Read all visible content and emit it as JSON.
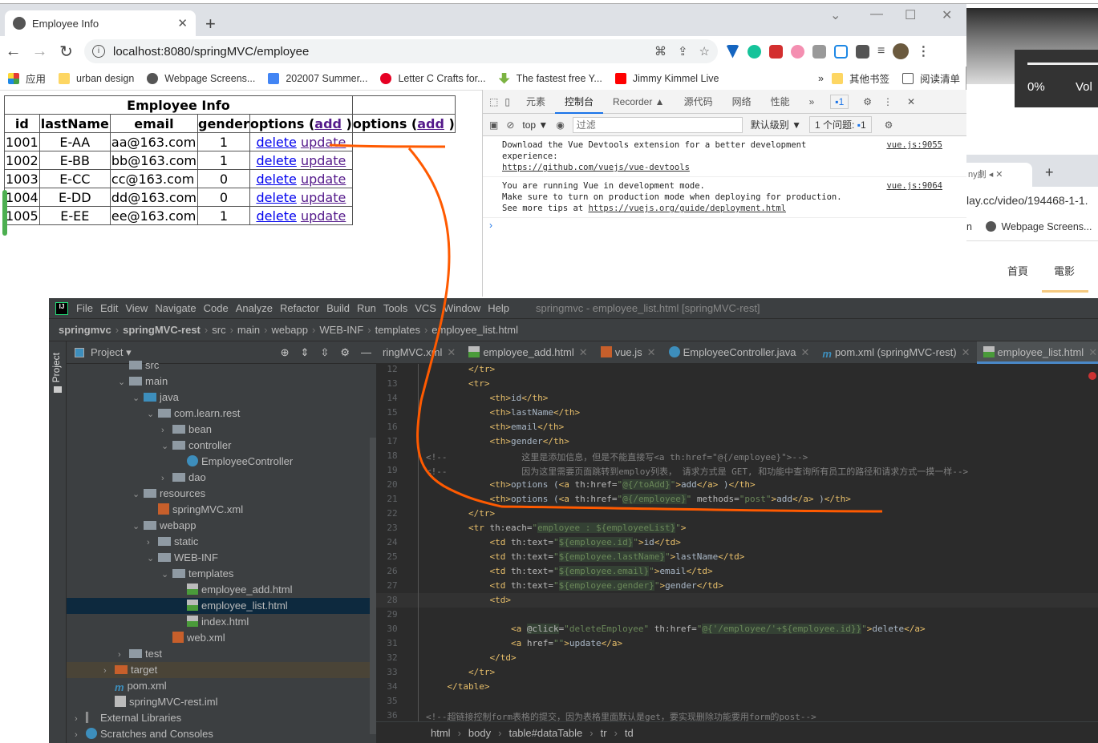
{
  "chrome": {
    "tab_title": "Employee Info",
    "url": "localhost:8080/springMVC/employee",
    "bookmarks": [
      "应用",
      "urban design",
      "Webpage Screens...",
      "202007 Summer...",
      "Letter C Crafts for...",
      "The fastest free Y...",
      "Jimmy Kimmel Live",
      "其他书签",
      "阅读清单"
    ],
    "more_bookmarks": "»"
  },
  "page": {
    "table_caption": "Employee Info",
    "headers": [
      "id",
      "lastName",
      "email",
      "gender"
    ],
    "options_label": "options (",
    "add_label": "add",
    "close_paren": " )",
    "rows": [
      {
        "id": "1001",
        "lastName": "E-AA",
        "email": "aa@163.com",
        "gender": "1"
      },
      {
        "id": "1002",
        "lastName": "E-BB",
        "email": "bb@163.com",
        "gender": "1"
      },
      {
        "id": "1003",
        "lastName": "E-CC",
        "email": "cc@163.com",
        "gender": "0"
      },
      {
        "id": "1004",
        "lastName": "E-DD",
        "email": "dd@163.com",
        "gender": "0"
      },
      {
        "id": "1005",
        "lastName": "E-EE",
        "email": "ee@163.com",
        "gender": "1"
      }
    ],
    "delete_label": "delete",
    "update_label": "update"
  },
  "devtools": {
    "tabs": [
      "元素",
      "控制台",
      "Recorder ▲",
      "源代码",
      "网络",
      "性能",
      "»"
    ],
    "active_tab": "控制台",
    "issues_badge": "1",
    "context": "top ▼",
    "filter_placeholder": "过滤",
    "level": "默认级别 ▼",
    "issues_label": "1 个问题:",
    "issues_count": "1",
    "messages": [
      {
        "lines": [
          "Download the Vue Devtools extension for a better development",
          "experience:"
        ],
        "link": "https://github.com/vuejs/vue-devtools",
        "src": "vue.js:9055"
      },
      {
        "lines": [
          "You are running Vue in development mode.",
          "Make sure to turn on production mode when deploying for production."
        ],
        "prefix": "See more tips at ",
        "link": "https://vuejs.org/guide/deployment.html",
        "src": "vue.js:9064"
      }
    ],
    "prompt": "›"
  },
  "background_window": {
    "volume_percent": "0%",
    "volume_label": "Vol",
    "tab_title": "ny劇",
    "url": "lay.cc/video/194468-1-1.",
    "bookmark_prefix": "n",
    "bookmark": "Webpage Screens...",
    "nav": [
      "首頁",
      "電影"
    ]
  },
  "ide": {
    "menus": [
      "File",
      "Edit",
      "View",
      "Navigate",
      "Code",
      "Analyze",
      "Refactor",
      "Build",
      "Run",
      "Tools",
      "VCS",
      "Window",
      "Help"
    ],
    "title": "springmvc - employee_list.html [springMVC-rest]",
    "breadcrumbs": [
      "springmvc",
      "springMVC-rest",
      "src",
      "main",
      "webapp",
      "WEB-INF",
      "templates",
      "employee_list.html"
    ],
    "project_label": "Project ▾",
    "side_label": "Project",
    "tree": [
      {
        "label": "src",
        "depth": 3,
        "chev": "",
        "type": "folder"
      },
      {
        "label": "main",
        "depth": 3,
        "chev": "⌄",
        "type": "folder"
      },
      {
        "label": "java",
        "depth": 4,
        "chev": "⌄",
        "type": "folder-blue"
      },
      {
        "label": "com.learn.rest",
        "depth": 5,
        "chev": "⌄",
        "type": "package"
      },
      {
        "label": "bean",
        "depth": 6,
        "chev": "›",
        "type": "package"
      },
      {
        "label": "controller",
        "depth": 6,
        "chev": "⌄",
        "type": "package"
      },
      {
        "label": "EmployeeController",
        "depth": 7,
        "chev": "",
        "type": "class"
      },
      {
        "label": "dao",
        "depth": 6,
        "chev": "›",
        "type": "package"
      },
      {
        "label": "resources",
        "depth": 4,
        "chev": "⌄",
        "type": "folder"
      },
      {
        "label": "springMVC.xml",
        "depth": 5,
        "chev": "",
        "type": "xml"
      },
      {
        "label": "webapp",
        "depth": 4,
        "chev": "⌄",
        "type": "folder"
      },
      {
        "label": "static",
        "depth": 5,
        "chev": "›",
        "type": "folder"
      },
      {
        "label": "WEB-INF",
        "depth": 5,
        "chev": "⌄",
        "type": "folder"
      },
      {
        "label": "templates",
        "depth": 6,
        "chev": "⌄",
        "type": "folder"
      },
      {
        "label": "employee_add.html",
        "depth": 7,
        "chev": "",
        "type": "html"
      },
      {
        "label": "employee_list.html",
        "depth": 7,
        "chev": "",
        "type": "html",
        "selected": true
      },
      {
        "label": "index.html",
        "depth": 7,
        "chev": "",
        "type": "html"
      },
      {
        "label": "web.xml",
        "depth": 6,
        "chev": "",
        "type": "xml"
      },
      {
        "label": "test",
        "depth": 3,
        "chev": "›",
        "type": "folder"
      },
      {
        "label": "target",
        "depth": 2,
        "chev": "›",
        "type": "folder-orange",
        "target": true
      },
      {
        "label": "pom.xml",
        "depth": 2,
        "chev": "",
        "type": "maven"
      },
      {
        "label": "springMVC-rest.iml",
        "depth": 2,
        "chev": "",
        "type": "iml"
      },
      {
        "label": "External Libraries",
        "depth": 0,
        "chev": "›",
        "type": "lib"
      },
      {
        "label": "Scratches and Consoles",
        "depth": 0,
        "chev": "›",
        "type": "scratch"
      }
    ],
    "editor_tabs": [
      {
        "label": "ringMVC.xml",
        "type": "xml"
      },
      {
        "label": "employee_add.html",
        "type": "html"
      },
      {
        "label": "vue.js",
        "type": "js"
      },
      {
        "label": "EmployeeController.java",
        "type": "class"
      },
      {
        "label": "pom.xml (springMVC-rest)",
        "type": "maven"
      },
      {
        "label": "employee_list.html",
        "type": "html",
        "active": true
      }
    ],
    "code_lines": [
      {
        "n": "12",
        "html": "        <span class='tag'>&lt;/tr&gt;</span>"
      },
      {
        "n": "13",
        "html": "        <span class='tag'>&lt;tr&gt;</span>"
      },
      {
        "n": "14",
        "html": "            <span class='tag'>&lt;th&gt;</span>id<span class='tag'>&lt;/th&gt;</span>"
      },
      {
        "n": "15",
        "html": "            <span class='tag'>&lt;th&gt;</span>lastName<span class='tag'>&lt;/th&gt;</span>"
      },
      {
        "n": "16",
        "html": "            <span class='tag'>&lt;th&gt;</span>email<span class='tag'>&lt;/th&gt;</span>"
      },
      {
        "n": "17",
        "html": "            <span class='tag'>&lt;th&gt;</span>gender<span class='tag'>&lt;/th&gt;</span>"
      },
      {
        "n": "18",
        "html": "<span class='cm'>&lt;!--              这里是添加信息，但是不能直接写&lt;a th:href=\"@{/employee}\"&gt;--&gt;</span>"
      },
      {
        "n": "19",
        "html": "<span class='cm'>&lt;!--              因为这里需要页面跳转到employ列表， 请求方式是 GET, 和功能中查询所有员工的路径和请求方式一摸一样--&gt;</span>"
      },
      {
        "n": "20",
        "html": "            <span class='tag'>&lt;th&gt;</span>options (<span class='tag'>&lt;a </span><span class='attr'>th:href=</span><span class='str'>\"<span class='hl'>@{/toAdd}</span>\"</span><span class='tag'>&gt;</span>add<span class='tag'>&lt;/a&gt;</span> )<span class='tag'>&lt;/th&gt;</span>"
      },
      {
        "n": "21",
        "html": "            <span class='tag'>&lt;th&gt;</span>options (<span class='tag'>&lt;a </span><span class='attr'>th:href=</span><span class='str'>\"<span class='hl'>@{/employee}</span>\"</span> <span class='attr'>methods=</span><span class='str'>\"post\"</span><span class='tag'>&gt;</span>add<span class='tag'>&lt;/a&gt;</span> )<span class='tag'>&lt;/th&gt;</span>"
      },
      {
        "n": "22",
        "html": "        <span class='tag'>&lt;/tr&gt;</span>"
      },
      {
        "n": "23",
        "html": "        <span class='tag'>&lt;tr </span><span class='attr'>th:each=</span><span class='str'>\"<span class='hl'>employee : ${employeeList}</span>\"</span><span class='tag'>&gt;</span>"
      },
      {
        "n": "24",
        "html": "            <span class='tag'>&lt;td </span><span class='attr'>th:text=</span><span class='str'>\"<span class='hl'>${employee.id}</span>\"</span><span class='tag'>&gt;</span>id<span class='tag'>&lt;/td&gt;</span>"
      },
      {
        "n": "25",
        "html": "            <span class='tag'>&lt;td </span><span class='attr'>th:text=</span><span class='str'>\"<span class='hl'>${employee.lastName}</span>\"</span><span class='tag'>&gt;</span>lastName<span class='tag'>&lt;/td&gt;</span>"
      },
      {
        "n": "26",
        "html": "            <span class='tag'>&lt;td </span><span class='attr'>th:text=</span><span class='str'>\"<span class='hl'>${employee.email}</span>\"</span><span class='tag'>&gt;</span>email<span class='tag'>&lt;/td&gt;</span>"
      },
      {
        "n": "27",
        "html": "            <span class='tag'>&lt;td </span><span class='attr'>th:text=</span><span class='str'>\"<span class='hl'>${employee.gender}</span>\"</span><span class='tag'>&gt;</span>gender<span class='tag'>&lt;/td&gt;</span>"
      },
      {
        "n": "28",
        "html": "            <span class='tag'>&lt;td&gt;</span>"
      },
      {
        "n": "29",
        "html": ""
      },
      {
        "n": "30",
        "html": "                <span class='tag'>&lt;a </span><span class='attr hl'>@click</span><span class='attr'>=</span><span class='str'>\"deleteEmployee\"</span> <span class='attr'>th:href=</span><span class='str'>\"<span class='hl'>@{'/employee/'+${employee.id}}</span>\"</span><span class='tag'>&gt;</span>delete<span class='tag'>&lt;/a&gt;</span>"
      },
      {
        "n": "31",
        "html": "                <span class='tag'>&lt;a </span><span class='attr'>href=</span><span class='str'>\"\"</span><span class='tag'>&gt;</span>update<span class='tag'>&lt;/a&gt;</span>"
      },
      {
        "n": "32",
        "html": "            <span class='tag'>&lt;/td&gt;</span>"
      },
      {
        "n": "33",
        "html": "        <span class='tag'>&lt;/tr&gt;</span>"
      },
      {
        "n": "34",
        "html": "    <span class='tag'>&lt;/table&gt;</span>"
      },
      {
        "n": "35",
        "html": ""
      },
      {
        "n": "36",
        "html": "<span class='cm'>&lt;!--超链接控制form表格的提交，因为表格里面默认是get，要实现删除功能要用form的post--&gt;</span>"
      }
    ],
    "status_path": [
      "html",
      "body",
      "table#dataTable",
      "tr",
      "td"
    ]
  }
}
